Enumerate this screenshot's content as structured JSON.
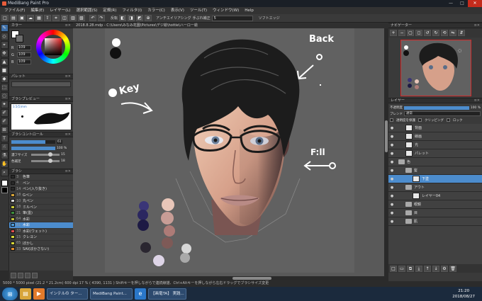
{
  "app": {
    "title": "MediBang Paint Pro",
    "window_buttons": [
      "—",
      "□",
      "✕"
    ]
  },
  "menu": [
    "ファイル(F)",
    "編集(E)",
    "レイヤー(L)",
    "選択範囲(S)",
    "定規(R)",
    "フィルタ(I)",
    "カラー(C)",
    "表示(V)",
    "ツール(T)",
    "ウィンドウ(W)",
    "Help"
  ],
  "toolbar": {
    "undo": "↶",
    "redo": "↷",
    "reverse_label": "反転",
    "antialias_label": "アンチエイリアシング",
    "correction_label": "手ぶれ補正",
    "correction_value": "5",
    "soft_edge_label": "ソフトエッジ"
  },
  "document": {
    "tab": "2018.8.28.mdp - C:\\Users\\みなみ花園\\Pictures\\デジ絵\\hottie\\ハーロー絵"
  },
  "panels": {
    "color": {
      "title": "カラー",
      "r": "109",
      "g": "109",
      "b": "109",
      "r_label": "R",
      "g_label": "G",
      "b_label": "B"
    },
    "palette": {
      "title": "パレット"
    },
    "brush_preview": {
      "title": "ブラシプレビュー",
      "size_label": "3.5(5)mm"
    },
    "brush_control": {
      "title": "ブラシコントロール",
      "size_value": "61",
      "opacity_value": "100 %",
      "flow_label": "濃フサイズ",
      "flow_value": "15",
      "mix_label": "色補足",
      "mix_value": "18"
    },
    "brush": {
      "title": "ブラシ",
      "items": [
        {
          "size": "3",
          "name": "色筆",
          "color": "#2a2a2a"
        },
        {
          "size": "4",
          "name": "ペン",
          "color": "#2a2a2a"
        },
        {
          "size": "14",
          "name": "ペン(入り抜き)",
          "color": "#2a2a2a"
        },
        {
          "size": "18",
          "name": "Gペン",
          "color": "#d9a53a"
        },
        {
          "size": "10",
          "name": "丸ペン",
          "color": "#d8d8d8"
        },
        {
          "size": "18",
          "name": "ミルペン",
          "color": "#c8c838"
        },
        {
          "size": "21",
          "name": "筆(墨)",
          "color": "#3d8f3d"
        },
        {
          "size": "64",
          "name": "水彩",
          "color": "#c3c33b"
        },
        {
          "size": "61",
          "name": "水彩",
          "color": "#4e9fe0"
        },
        {
          "size": "33",
          "name": "水彩(ウェット)",
          "color": "#df4f4f"
        },
        {
          "size": "15",
          "name": "クレヨン",
          "color": "#d8d838"
        },
        {
          "size": "65",
          "name": "ぼかし",
          "color": "#d8d838"
        },
        {
          "size": "33",
          "name": "SAI(ぼかさない)",
          "color": "#e28c2c"
        }
      ],
      "selected": 8
    },
    "navigator": {
      "title": "ナビゲーター"
    },
    "layer": {
      "title": "レイヤー",
      "opacity_label": "不透明度",
      "opacity_value": "100 %",
      "blend_label": "ブレンド",
      "blend_value": "通常",
      "protect_label": "透明度を保護",
      "clipping_label": "クリッピング",
      "lock_label": "ロック",
      "rows": [
        {
          "name": "背面",
          "kind": "layer",
          "indent": 1
        },
        {
          "name": "線画",
          "kind": "layer",
          "indent": 1
        },
        {
          "name": "光",
          "kind": "layer",
          "indent": 1
        },
        {
          "name": "パレット",
          "kind": "layer",
          "indent": 1
        },
        {
          "name": "色",
          "kind": "folder",
          "indent": 0
        },
        {
          "name": "髪",
          "kind": "folder",
          "indent": 1
        },
        {
          "name": "下塗",
          "kind": "layer",
          "indent": 2
        },
        {
          "name": "アウト",
          "kind": "folder",
          "indent": 1
        },
        {
          "name": "レイヤー04",
          "kind": "layer",
          "indent": 2
        },
        {
          "name": "眼鏡",
          "kind": "folder",
          "indent": 1
        },
        {
          "name": "目",
          "kind": "folder",
          "indent": 1
        },
        {
          "name": "肌",
          "kind": "folder",
          "indent": 1
        }
      ],
      "selected": 6
    }
  },
  "canvas": {
    "annotations": {
      "back": "Back",
      "key": "Key",
      "fill": "F:ll"
    }
  },
  "status": {
    "text": "5000 * 5000 pixel  (21.2 * 21.2cm)  600 dpi  17 %  ( 4390, 1131 )  Shiftキーを押しながらで連続線描、Ctrl+Altキーを押しながら左右ドラッグでブラシサイズ変更"
  },
  "taskbar": {
    "apps": [
      "インテルの ター...",
      "MediBang Paint...",
      "【画竜TA】 実践..."
    ],
    "time": "21:20",
    "date": "2018/08/27"
  },
  "colors": {
    "accent": "#4c8ccd",
    "panel_bg": "#3c3c3c",
    "canvas_bg": "#595959",
    "taskbar_bg": "#1b2a3d"
  }
}
